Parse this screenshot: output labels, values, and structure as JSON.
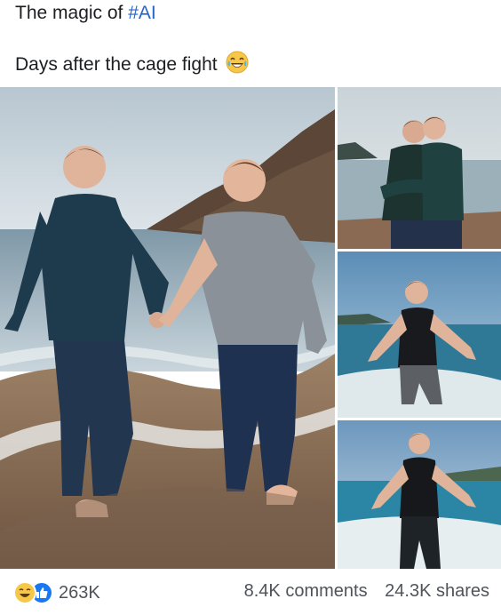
{
  "post": {
    "line1_prefix": "The magic of ",
    "hashtag": "#AI",
    "line2": "Days after the cage fight",
    "line2_emoji": "laughing-crying-emoji"
  },
  "images": [
    {
      "label": "main-beach-walk-photo"
    },
    {
      "label": "hug-photo"
    },
    {
      "label": "runner-photo-1"
    },
    {
      "label": "runner-photo-2"
    }
  ],
  "footer": {
    "reaction_icons": [
      "haha-icon",
      "like-icon"
    ],
    "reaction_count": "263K",
    "comments": "8.4K comments",
    "shares": "24.3K shares"
  },
  "colors": {
    "hashtag": "#2566c9",
    "like_blue": "#1877f2",
    "haha_yellow": "#f7c74a",
    "meta_text": "#50545a"
  }
}
